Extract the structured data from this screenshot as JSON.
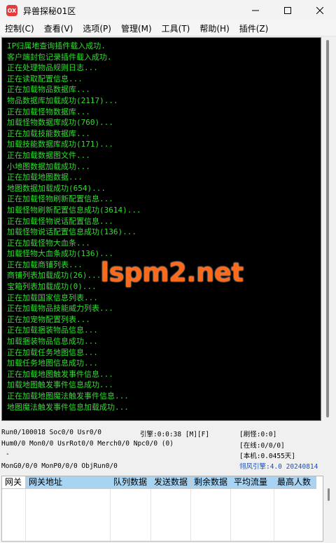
{
  "window": {
    "title": "异兽探秘01区",
    "icon_text": "OX",
    "controls": [
      "minimize-icon",
      "maximize-icon",
      "close-icon"
    ]
  },
  "menu": [
    {
      "label": "控制(C)"
    },
    {
      "label": "查看(V)"
    },
    {
      "label": "选项(P)"
    },
    {
      "label": "管理(M)"
    },
    {
      "label": "工具(T)"
    },
    {
      "label": "帮助(H)"
    },
    {
      "label": "插件(Z)"
    }
  ],
  "console": {
    "text_color": "#33dd33",
    "lines": [
      "IP归属地查询插件载入成功.",
      "客户端封包记录插件载入成功.",
      "正在处理物品规则日志...",
      "正在读取配置信息...",
      "正在加载物品数据库...",
      "物品数据库加载成功(2117)...",
      "正在加载怪物数据库...",
      "加载怪物数据库成功(760)...",
      "正在加载技能数据库...",
      "加载技能数据库成功(171)...",
      "正在加载数据图文件...",
      "小地图数据加载成功...",
      "正在加载地图数据...",
      "地图数据加载成功(654)...",
      "正在加载怪物刷新配置信息...",
      "加载怪物刷新配置信息成功(3614)...",
      "正在加载怪物说话配置信息...",
      "加载怪物说话配置信息成功(136)...",
      "正在加载怪物大血条...",
      "加载怪物大血条成功(136)...",
      "正在加载商铺列表...",
      "商铺列表加载成功(26)...",
      "宝箱列表加载成功(0)...",
      "正在加载国家信息列表...",
      "正在加载物品技能威力列表...",
      "正在加宠物配置列表...",
      "正在加载捆装物品信息...",
      "加载捆装物品信息成功...",
      "正在加载任务地图信息...",
      "加载任务地图信息成功...",
      "正在加载地图触发事件信息...",
      "加载地图触发事件信息成功...",
      "正在加载地图魔法触发事件信息...",
      "地图魔法触发事件信息加载成功..."
    ]
  },
  "watermark": "lspm2.net",
  "status": {
    "run": "Run0/100018 Soc0/0 Usr0/0",
    "engine": "引擎:0:0:38 [M][F]",
    "refresh_monster": "[刷怪:0:0]",
    "hum": "Hum0/0 Mon0/0 UsrRot0/0 Merch0/0 Npc0/0 (0)",
    "online": "[在线:0/0/0]",
    "dash": "-",
    "local": "[本机:0.0455天]",
    "mong": "MonG0/0/0 MonP0/0/0 ObjRun0/0",
    "version": "翎风引擎:4.0 20240814"
  },
  "grid": {
    "headers": [
      "网关",
      "网关地址",
      "队列数据",
      "发送数据",
      "剩余数据",
      "平均流量",
      "最高人数"
    ],
    "rows": []
  }
}
